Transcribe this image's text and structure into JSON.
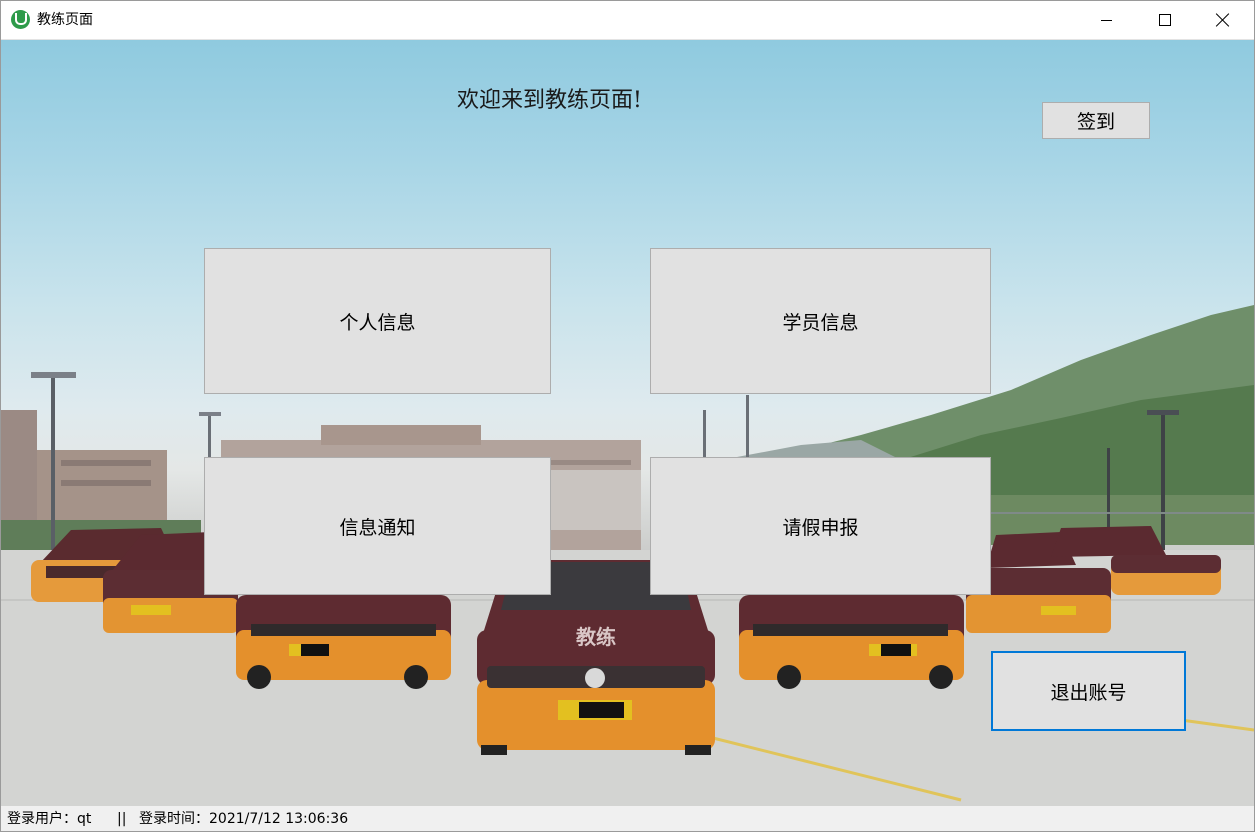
{
  "window": {
    "title": "教练页面",
    "app_icon": "app-logo-icon",
    "controls": {
      "minimize_icon": "minimize-icon",
      "maximize_icon": "maximize-icon",
      "close_icon": "close-icon"
    }
  },
  "main": {
    "welcome_text": "欢迎来到教练页面!",
    "checkin_label": "签到",
    "personal_info_label": "个人信息",
    "student_info_label": "学员信息",
    "notice_label": "信息通知",
    "leave_label": "请假申报",
    "logout_label": "退出账号",
    "car_hood_text": "教练",
    "accent_color": "#0078d7"
  },
  "statusbar": {
    "user_text": "登录用户：qt",
    "separator": "||",
    "login_time_text": "登录时间：2021/7/12 13:06:36"
  }
}
